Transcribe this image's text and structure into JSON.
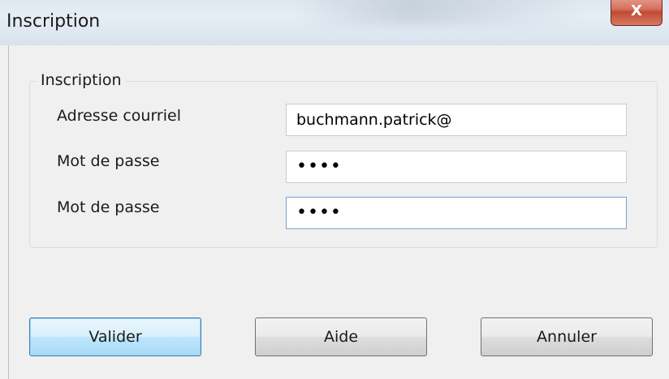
{
  "window": {
    "title": "Inscription",
    "close_glyph": "X"
  },
  "group": {
    "title": "Inscription"
  },
  "form": {
    "email_label": "Adresse courriel",
    "email_value": "buchmann.patrick@",
    "password_label": "Mot de passe",
    "password_value": "••••",
    "confirm_label": "Mot de passe",
    "confirm_value": "••••"
  },
  "buttons": {
    "validate": "Valider",
    "help": "Aide",
    "cancel": "Annuler"
  }
}
